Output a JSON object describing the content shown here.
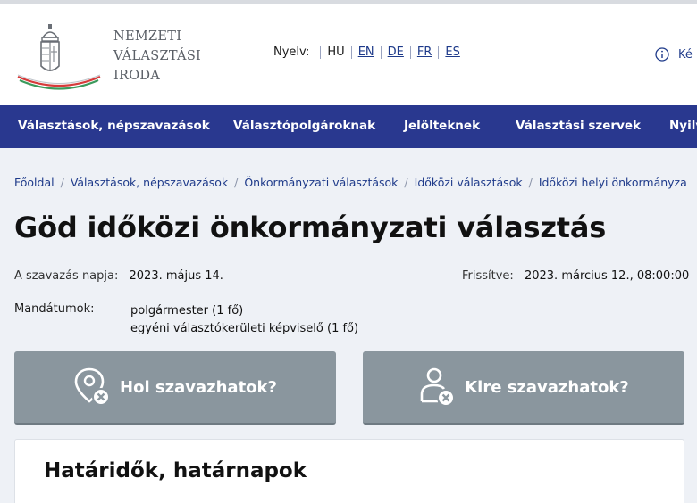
{
  "logo": {
    "lines": [
      "NEMZETI",
      "VÁLASZTÁSI",
      "IRODA"
    ],
    "icon": "coat-of-arms-icon"
  },
  "language": {
    "label": "Nyelv:",
    "current": "HU",
    "options": [
      "EN",
      "DE",
      "FR",
      "ES"
    ]
  },
  "header_info": {
    "icon": "info-icon",
    "text": "Ké"
  },
  "nav": {
    "items": [
      "Választások, népszavazások",
      "Választópolgároknak",
      "Jelölteknek",
      "Választási szervek",
      "Nyilv"
    ]
  },
  "breadcrumb": [
    "Főoldal",
    "Választások, népszavazások",
    "Önkormányzati választások",
    "Időközi választások",
    "Időközi helyi önkormányza"
  ],
  "page_title": "Göd időközi önkormányzati választás",
  "election": {
    "vote_day_label": "A szavazás napja:",
    "vote_day_value": "2023. május 14.",
    "updated_label": "Frissítve:",
    "updated_value": "2023. március 12., 08:00:00",
    "mandates_label": "Mandátumok:",
    "mandates": [
      "polgármester (1 fő)",
      "egyéni választókerületi képviselő (1 fő)"
    ]
  },
  "actions": {
    "where_label": "Hol szavazhatok?",
    "who_label": "Kire szavazhatok?"
  },
  "deadlines": {
    "title": "Határidők, határnapok"
  },
  "colors": {
    "nav": "#29388f",
    "button": "#8a969e",
    "link": "#1e3a8a",
    "background": "#eef1f6"
  }
}
